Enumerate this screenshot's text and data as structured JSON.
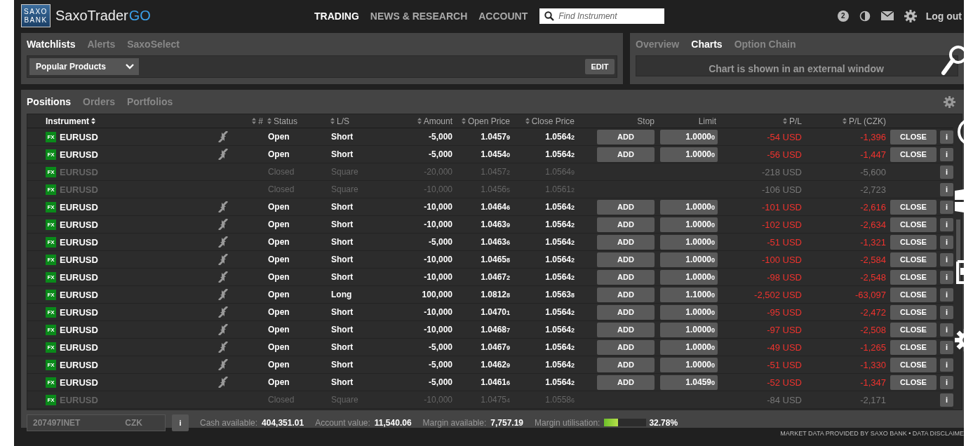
{
  "brand": {
    "logo_top": "SAXO",
    "logo_bottom": "BANK",
    "name": "SaxoTrader",
    "suffix": "GO"
  },
  "nav": [
    {
      "label": "TRADING",
      "selected": true
    },
    {
      "label": "NEWS & RESEARCH",
      "selected": false
    },
    {
      "label": "ACCOUNT",
      "selected": false
    }
  ],
  "search": {
    "placeholder": "Find Instrument"
  },
  "notifications": {
    "count": "2"
  },
  "logout": "Log out",
  "watchlist_panel": {
    "tabs": [
      {
        "label": "Watchlists",
        "selected": true
      },
      {
        "label": "Alerts",
        "selected": false
      },
      {
        "label": "SaxoSelect",
        "selected": false
      }
    ],
    "dropdown": "Popular Products",
    "edit": "EDIT"
  },
  "chart_panel": {
    "tabs": [
      {
        "label": "Overview",
        "selected": false
      },
      {
        "label": "Charts",
        "selected": true
      },
      {
        "label": "Option Chain",
        "selected": false
      }
    ],
    "message": "Chart is shown in an external window"
  },
  "positions_panel": {
    "tabs": [
      {
        "label": "Positions",
        "selected": true
      },
      {
        "label": "Orders",
        "selected": false
      },
      {
        "label": "Portfolios",
        "selected": false
      }
    ],
    "columns": [
      {
        "label": "Instrument",
        "sortable": true,
        "sorted": true
      },
      {
        "label": "#",
        "sortable": true,
        "sorted": false
      },
      {
        "label": "Status",
        "sortable": true,
        "sorted": false
      },
      {
        "label": "L/S",
        "sortable": true,
        "sorted": false
      },
      {
        "label": "Amount",
        "sortable": true,
        "sorted": false
      },
      {
        "label": "Open Price",
        "sortable": true,
        "sorted": false
      },
      {
        "label": "Close Price",
        "sortable": true,
        "sorted": false
      },
      {
        "label": "Stop",
        "sortable": false,
        "sorted": false
      },
      {
        "label": "Limit",
        "sortable": false,
        "sorted": false
      },
      {
        "label": "P/L",
        "sortable": true,
        "sorted": false
      },
      {
        "label": "P/L (CZK)",
        "sortable": true,
        "sorted": false
      }
    ],
    "rows": [
      {
        "kind": "open",
        "badge": "FX",
        "instrument": "EURUSD",
        "status": "Open",
        "side": "Short",
        "amount": "-5,000",
        "open_price": "1.0457$_{9}$",
        "close_price": "1.0564$_{2}$",
        "stop": "ADD",
        "limit": "1.0000$_{0}$",
        "pl": "-54 USD",
        "pl_czk": "-1,396",
        "close": "CLOSE",
        "info": "i"
      },
      {
        "kind": "open",
        "badge": "FX",
        "instrument": "EURUSD",
        "status": "Open",
        "side": "Short",
        "amount": "-5,000",
        "open_price": "1.0454$_{0}$",
        "close_price": "1.0564$_{2}$",
        "stop": "ADD",
        "limit": "1.0000$_{0}$",
        "pl": "-56 USD",
        "pl_czk": "-1,447",
        "close": "CLOSE",
        "info": "i"
      },
      {
        "kind": "closed",
        "badge": "FX",
        "instrument": "EURUSD",
        "status": "Closed",
        "side": "Square",
        "amount": "-20,000",
        "open_price": "1.0457$_{2}$",
        "close_price": "1.0564$_{9}$",
        "pl": "-218 USD",
        "pl_czk": "-5,600",
        "info": "i"
      },
      {
        "kind": "closed",
        "badge": "FX",
        "instrument": "EURUSD",
        "status": "Closed",
        "side": "Square",
        "amount": "-10,000",
        "open_price": "1.0456$_{5}$",
        "close_price": "1.0561$_{2}$",
        "pl": "-106 USD",
        "pl_czk": "-2,723",
        "info": "i"
      },
      {
        "kind": "open",
        "badge": "FX",
        "instrument": "EURUSD",
        "status": "Open",
        "side": "Short",
        "amount": "-10,000",
        "open_price": "1.0464$_{6}$",
        "close_price": "1.0564$_{2}$",
        "stop": "ADD",
        "limit": "1.0000$_{0}$",
        "pl": "-101 USD",
        "pl_czk": "-2,616",
        "close": "CLOSE",
        "info": "i"
      },
      {
        "kind": "open",
        "badge": "FX",
        "instrument": "EURUSD",
        "status": "Open",
        "side": "Short",
        "amount": "-10,000",
        "open_price": "1.0463$_{9}$",
        "close_price": "1.0564$_{2}$",
        "stop": "ADD",
        "limit": "1.0000$_{0}$",
        "pl": "-102 USD",
        "pl_czk": "-2,634",
        "close": "CLOSE",
        "info": "i"
      },
      {
        "kind": "open",
        "badge": "FX",
        "instrument": "EURUSD",
        "status": "Open",
        "side": "Short",
        "amount": "-5,000",
        "open_price": "1.0463$_{6}$",
        "close_price": "1.0564$_{2}$",
        "stop": "ADD",
        "limit": "1.0000$_{0}$",
        "pl": "-51 USD",
        "pl_czk": "-1,321",
        "close": "CLOSE",
        "info": "i"
      },
      {
        "kind": "open",
        "badge": "FX",
        "instrument": "EURUSD",
        "status": "Open",
        "side": "Short",
        "amount": "-10,000",
        "open_price": "1.0465$_{8}$",
        "close_price": "1.0564$_{2}$",
        "stop": "ADD",
        "limit": "1.0000$_{0}$",
        "pl": "-100 USD",
        "pl_czk": "-2,584",
        "close": "CLOSE",
        "info": "i"
      },
      {
        "kind": "open",
        "badge": "FX",
        "instrument": "EURUSD",
        "status": "Open",
        "side": "Short",
        "amount": "-10,000",
        "open_price": "1.0467$_{2}$",
        "close_price": "1.0564$_{2}$",
        "stop": "ADD",
        "limit": "1.0000$_{0}$",
        "pl": "-98 USD",
        "pl_czk": "-2,548",
        "close": "CLOSE",
        "info": "i"
      },
      {
        "kind": "open",
        "badge": "FX",
        "instrument": "EURUSD",
        "status": "Open",
        "side": "Long",
        "amount": "100,000",
        "open_price": "1.0812$_{8}$",
        "close_price": "1.0563$_{8}$",
        "stop": "ADD",
        "limit": "1.1000$_{0}$",
        "pl": "-2,502 USD",
        "pl_czk": "-63,097",
        "close": "CLOSE",
        "info": "i"
      },
      {
        "kind": "open",
        "badge": "FX",
        "instrument": "EURUSD",
        "status": "Open",
        "side": "Short",
        "amount": "-10,000",
        "open_price": "1.0470$_{1}$",
        "close_price": "1.0564$_{2}$",
        "stop": "ADD",
        "limit": "1.0000$_{0}$",
        "pl": "-95 USD",
        "pl_czk": "-2,472",
        "close": "CLOSE",
        "info": "i"
      },
      {
        "kind": "open",
        "badge": "FX",
        "instrument": "EURUSD",
        "status": "Open",
        "side": "Short",
        "amount": "-10,000",
        "open_price": "1.0468$_{7}$",
        "close_price": "1.0564$_{2}$",
        "stop": "ADD",
        "limit": "1.0000$_{0}$",
        "pl": "-97 USD",
        "pl_czk": "-2,508",
        "close": "CLOSE",
        "info": "i"
      },
      {
        "kind": "open",
        "badge": "FX",
        "instrument": "EURUSD",
        "status": "Open",
        "side": "Short",
        "amount": "-5,000",
        "open_price": "1.0467$_{9}$",
        "close_price": "1.0564$_{2}$",
        "stop": "ADD",
        "limit": "1.0000$_{0}$",
        "pl": "-49 USD",
        "pl_czk": "-1,265",
        "close": "CLOSE",
        "info": "i"
      },
      {
        "kind": "open",
        "badge": "FX",
        "instrument": "EURUSD",
        "status": "Open",
        "side": "Short",
        "amount": "-5,000",
        "open_price": "1.0462$_{9}$",
        "close_price": "1.0564$_{2}$",
        "stop": "ADD",
        "limit": "1.0000$_{0}$",
        "pl": "-51 USD",
        "pl_czk": "-1,330",
        "close": "CLOSE",
        "info": "i"
      },
      {
        "kind": "open",
        "badge": "FX",
        "instrument": "EURUSD",
        "status": "Open",
        "side": "Short",
        "amount": "-5,000",
        "open_price": "1.0461$_{6}$",
        "close_price": "1.0564$_{2}$",
        "stop": "ADD",
        "limit": "1.0459$_{0}$",
        "pl": "-52 USD",
        "pl_czk": "-1,347",
        "close": "CLOSE",
        "info": "i"
      },
      {
        "kind": "closed",
        "badge": "FX",
        "instrument": "EURUSD",
        "status": "Closed",
        "side": "Square",
        "amount": "-10,000",
        "open_price": "1.0475$_{4}$",
        "close_price": "1.0558$_{6}$",
        "pl": "-84 USD",
        "pl_czk": "-2,171",
        "info": "i"
      }
    ],
    "footer": {
      "account": "207497INET",
      "currency": "CZK",
      "info": "i",
      "stats": [
        {
          "label": "Cash available:",
          "value": "404,351.01"
        },
        {
          "label": "Account value:",
          "value": "11,540.06"
        },
        {
          "label": "Margin available:",
          "value": "7,757.19"
        }
      ],
      "margin": {
        "label": "Margin utilisation:",
        "level": 0.33,
        "value": "32.78%"
      }
    }
  },
  "disclaimer": "MARKET DATA PROVIDED BY SAXO BANK • DATA DISCLAIME"
}
